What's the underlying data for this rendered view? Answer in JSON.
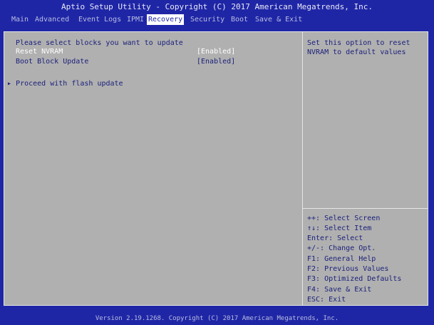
{
  "header": {
    "title": "Aptio Setup Utility - Copyright (C) 2017 American Megatrends, Inc."
  },
  "tabs": [
    {
      "label": "Main"
    },
    {
      "label": "Advanced"
    },
    {
      "label": "Event Logs"
    },
    {
      "label": "IPMI"
    },
    {
      "label": "Recovery"
    },
    {
      "label": "Security"
    },
    {
      "label": "Boot"
    },
    {
      "label": "Save & Exit"
    }
  ],
  "main": {
    "heading": "Please select blocks you want to update",
    "options": [
      {
        "label": "Reset NVRAM",
        "value": "[Enabled]"
      },
      {
        "label": "Boot Block Update",
        "value": "[Enabled]"
      }
    ],
    "action": "Proceed with flash update"
  },
  "help": {
    "description": [
      "Set this option to reset",
      "NVRAM to default values"
    ],
    "keys": [
      "++: Select Screen",
      "↑↓: Select Item",
      "Enter: Select",
      "+/-: Change Opt.",
      "F1: General Help",
      "F2: Previous Values",
      "F3: Optimized Defaults",
      "F4: Save & Exit",
      "ESC: Exit"
    ]
  },
  "footer": {
    "text": "Version 2.19.1268. Copyright (C) 2017 American Megatrends, Inc."
  },
  "colors": {
    "background": "#1f26a6",
    "panel": "#b0b0b0",
    "text_dark": "#1a1f7a",
    "highlight": "#ffffff"
  }
}
